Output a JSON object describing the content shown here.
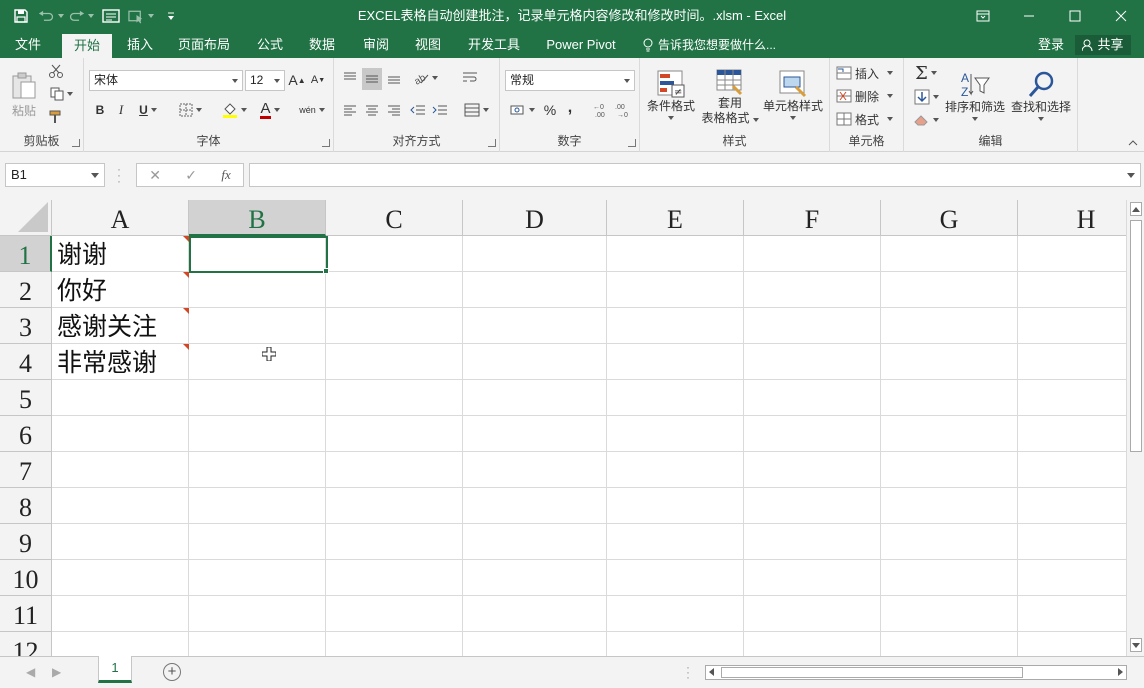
{
  "window": {
    "title": "EXCEL表格自动创建批注，记录单元格内容修改和修改时间。.xlsm - Excel",
    "accent": "#217346"
  },
  "quick_access": [
    "save-icon",
    "undo-icon",
    "redo-icon",
    "form-icon",
    "touch-mode-icon",
    "customize-icon"
  ],
  "tabs": [
    {
      "label": "文件",
      "active": false
    },
    {
      "label": "开始",
      "active": true
    },
    {
      "label": "插入",
      "active": false
    },
    {
      "label": "页面布局",
      "active": false
    },
    {
      "label": "公式",
      "active": false
    },
    {
      "label": "数据",
      "active": false
    },
    {
      "label": "审阅",
      "active": false
    },
    {
      "label": "视图",
      "active": false
    },
    {
      "label": "开发工具",
      "active": false
    },
    {
      "label": "Power Pivot",
      "active": false
    }
  ],
  "tell_me": "告诉我您想要做什么...",
  "login": "登录",
  "share": "共享",
  "ribbon": {
    "clipboard": {
      "label": "剪贴板",
      "paste": "粘贴"
    },
    "font": {
      "label": "字体",
      "name": "宋体",
      "size": "12",
      "bold": "B",
      "italic": "I",
      "underline": "U",
      "inc": "A",
      "dec": "A",
      "pinyin": "wén",
      "font_color": "A"
    },
    "alignment": {
      "label": "对齐方式"
    },
    "number": {
      "label": "数字",
      "format": "常规",
      "percent": "%",
      "comma": ","
    },
    "styles": {
      "label": "样式",
      "conditional": "条件格式",
      "table_1": "套用",
      "table_2": "表格格式",
      "cell_styles": "单元格样式"
    },
    "cells": {
      "label": "单元格",
      "insert": "插入",
      "delete": "删除",
      "format": "格式"
    },
    "editing": {
      "label": "编辑",
      "sort": "排序和筛选",
      "find": "查找和选择"
    }
  },
  "formula_bar": {
    "name_box": "B1",
    "formula": "",
    "fx": "fx"
  },
  "columns": [
    "A",
    "B",
    "C",
    "D",
    "E",
    "F",
    "G",
    "H"
  ],
  "rows": [
    "1",
    "2",
    "3",
    "4",
    "5",
    "6",
    "7",
    "8",
    "9",
    "10",
    "11",
    "12"
  ],
  "cells": {
    "A1": "谢谢",
    "A2": "你好",
    "A3": "感谢关注",
    "A4": "非常感谢"
  },
  "active_cell": "B1",
  "sheets": [
    {
      "name": "1",
      "active": true
    }
  ]
}
